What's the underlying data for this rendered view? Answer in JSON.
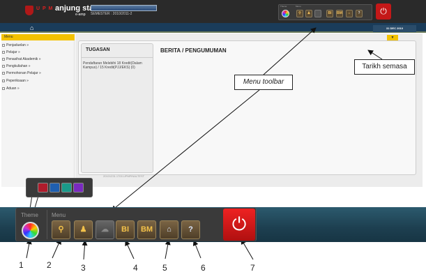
{
  "header": {
    "brand": "U P M",
    "title": "anjung staf",
    "subtitle": "e-amp",
    "semester": "SEMESTER : 2010/2011-2",
    "date": "31 DEC 2010"
  },
  "mini_toolbar": {
    "theme_label": "Theme",
    "menu_label": "Menu",
    "bi": "BI",
    "bm": "BM",
    "help": "?"
  },
  "sidebar": {
    "header": "Menu",
    "items": [
      "Penjaduelan »",
      "Pelajar »",
      "Penasihat Akademik »",
      "Pengkuliahan »",
      "Permohonan Pelajar »",
      "Peperiksaan »",
      "Aduan »"
    ]
  },
  "main": {
    "tugasan_title": "TUGASAN",
    "tugasan_text": "Pendaftaran Melebihi 18 Kredit(Dalam Kampus) / 15 Kredit(PJJ/EKS) (0)",
    "berita_title": "BERITA / PENGUMUMAN",
    "footer": "20101231.1700.UPMFINALTEST"
  },
  "callouts": {
    "tarikh": "Tarikh semasa",
    "menu_toolbar": "Menu toolbar"
  },
  "big_toolbar": {
    "theme_label": "Theme",
    "menu_label": "Menu",
    "bi": "BI",
    "bm": "BM",
    "help": "?",
    "palette_colors": [
      "#b01c2c",
      "#1f5fb0",
      "#1a9a8a",
      "#7a2ac0"
    ]
  },
  "numbers": [
    "1",
    "2",
    "3",
    "4",
    "5",
    "6",
    "7"
  ]
}
